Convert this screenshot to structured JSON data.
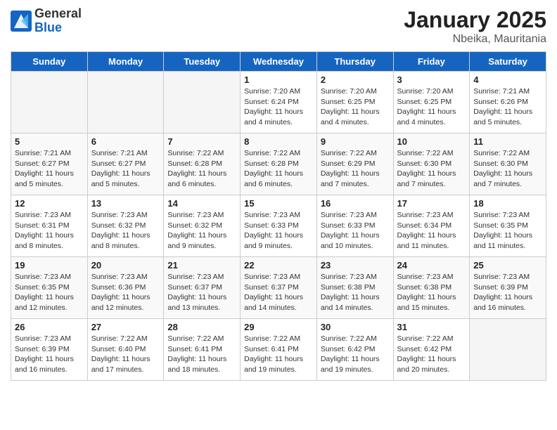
{
  "header": {
    "logo_general": "General",
    "logo_blue": "Blue",
    "month_title": "January 2025",
    "location": "Nbeika, Mauritania"
  },
  "weekdays": [
    "Sunday",
    "Monday",
    "Tuesday",
    "Wednesday",
    "Thursday",
    "Friday",
    "Saturday"
  ],
  "weeks": [
    [
      {
        "day": "",
        "sunrise": "",
        "sunset": "",
        "daylight": "",
        "empty": true
      },
      {
        "day": "",
        "sunrise": "",
        "sunset": "",
        "daylight": "",
        "empty": true
      },
      {
        "day": "",
        "sunrise": "",
        "sunset": "",
        "daylight": "",
        "empty": true
      },
      {
        "day": "1",
        "sunrise": "Sunrise: 7:20 AM",
        "sunset": "Sunset: 6:24 PM",
        "daylight": "Daylight: 11 hours and 4 minutes."
      },
      {
        "day": "2",
        "sunrise": "Sunrise: 7:20 AM",
        "sunset": "Sunset: 6:25 PM",
        "daylight": "Daylight: 11 hours and 4 minutes."
      },
      {
        "day": "3",
        "sunrise": "Sunrise: 7:20 AM",
        "sunset": "Sunset: 6:25 PM",
        "daylight": "Daylight: 11 hours and 4 minutes."
      },
      {
        "day": "4",
        "sunrise": "Sunrise: 7:21 AM",
        "sunset": "Sunset: 6:26 PM",
        "daylight": "Daylight: 11 hours and 5 minutes."
      }
    ],
    [
      {
        "day": "5",
        "sunrise": "Sunrise: 7:21 AM",
        "sunset": "Sunset: 6:27 PM",
        "daylight": "Daylight: 11 hours and 5 minutes."
      },
      {
        "day": "6",
        "sunrise": "Sunrise: 7:21 AM",
        "sunset": "Sunset: 6:27 PM",
        "daylight": "Daylight: 11 hours and 5 minutes."
      },
      {
        "day": "7",
        "sunrise": "Sunrise: 7:22 AM",
        "sunset": "Sunset: 6:28 PM",
        "daylight": "Daylight: 11 hours and 6 minutes."
      },
      {
        "day": "8",
        "sunrise": "Sunrise: 7:22 AM",
        "sunset": "Sunset: 6:28 PM",
        "daylight": "Daylight: 11 hours and 6 minutes."
      },
      {
        "day": "9",
        "sunrise": "Sunrise: 7:22 AM",
        "sunset": "Sunset: 6:29 PM",
        "daylight": "Daylight: 11 hours and 7 minutes."
      },
      {
        "day": "10",
        "sunrise": "Sunrise: 7:22 AM",
        "sunset": "Sunset: 6:30 PM",
        "daylight": "Daylight: 11 hours and 7 minutes."
      },
      {
        "day": "11",
        "sunrise": "Sunrise: 7:22 AM",
        "sunset": "Sunset: 6:30 PM",
        "daylight": "Daylight: 11 hours and 7 minutes."
      }
    ],
    [
      {
        "day": "12",
        "sunrise": "Sunrise: 7:23 AM",
        "sunset": "Sunset: 6:31 PM",
        "daylight": "Daylight: 11 hours and 8 minutes."
      },
      {
        "day": "13",
        "sunrise": "Sunrise: 7:23 AM",
        "sunset": "Sunset: 6:32 PM",
        "daylight": "Daylight: 11 hours and 8 minutes."
      },
      {
        "day": "14",
        "sunrise": "Sunrise: 7:23 AM",
        "sunset": "Sunset: 6:32 PM",
        "daylight": "Daylight: 11 hours and 9 minutes."
      },
      {
        "day": "15",
        "sunrise": "Sunrise: 7:23 AM",
        "sunset": "Sunset: 6:33 PM",
        "daylight": "Daylight: 11 hours and 9 minutes."
      },
      {
        "day": "16",
        "sunrise": "Sunrise: 7:23 AM",
        "sunset": "Sunset: 6:33 PM",
        "daylight": "Daylight: 11 hours and 10 minutes."
      },
      {
        "day": "17",
        "sunrise": "Sunrise: 7:23 AM",
        "sunset": "Sunset: 6:34 PM",
        "daylight": "Daylight: 11 hours and 11 minutes."
      },
      {
        "day": "18",
        "sunrise": "Sunrise: 7:23 AM",
        "sunset": "Sunset: 6:35 PM",
        "daylight": "Daylight: 11 hours and 11 minutes."
      }
    ],
    [
      {
        "day": "19",
        "sunrise": "Sunrise: 7:23 AM",
        "sunset": "Sunset: 6:35 PM",
        "daylight": "Daylight: 11 hours and 12 minutes."
      },
      {
        "day": "20",
        "sunrise": "Sunrise: 7:23 AM",
        "sunset": "Sunset: 6:36 PM",
        "daylight": "Daylight: 11 hours and 12 minutes."
      },
      {
        "day": "21",
        "sunrise": "Sunrise: 7:23 AM",
        "sunset": "Sunset: 6:37 PM",
        "daylight": "Daylight: 11 hours and 13 minutes."
      },
      {
        "day": "22",
        "sunrise": "Sunrise: 7:23 AM",
        "sunset": "Sunset: 6:37 PM",
        "daylight": "Daylight: 11 hours and 14 minutes."
      },
      {
        "day": "23",
        "sunrise": "Sunrise: 7:23 AM",
        "sunset": "Sunset: 6:38 PM",
        "daylight": "Daylight: 11 hours and 14 minutes."
      },
      {
        "day": "24",
        "sunrise": "Sunrise: 7:23 AM",
        "sunset": "Sunset: 6:38 PM",
        "daylight": "Daylight: 11 hours and 15 minutes."
      },
      {
        "day": "25",
        "sunrise": "Sunrise: 7:23 AM",
        "sunset": "Sunset: 6:39 PM",
        "daylight": "Daylight: 11 hours and 16 minutes."
      }
    ],
    [
      {
        "day": "26",
        "sunrise": "Sunrise: 7:23 AM",
        "sunset": "Sunset: 6:39 PM",
        "daylight": "Daylight: 11 hours and 16 minutes."
      },
      {
        "day": "27",
        "sunrise": "Sunrise: 7:22 AM",
        "sunset": "Sunset: 6:40 PM",
        "daylight": "Daylight: 11 hours and 17 minutes."
      },
      {
        "day": "28",
        "sunrise": "Sunrise: 7:22 AM",
        "sunset": "Sunset: 6:41 PM",
        "daylight": "Daylight: 11 hours and 18 minutes."
      },
      {
        "day": "29",
        "sunrise": "Sunrise: 7:22 AM",
        "sunset": "Sunset: 6:41 PM",
        "daylight": "Daylight: 11 hours and 19 minutes."
      },
      {
        "day": "30",
        "sunrise": "Sunrise: 7:22 AM",
        "sunset": "Sunset: 6:42 PM",
        "daylight": "Daylight: 11 hours and 19 minutes."
      },
      {
        "day": "31",
        "sunrise": "Sunrise: 7:22 AM",
        "sunset": "Sunset: 6:42 PM",
        "daylight": "Daylight: 11 hours and 20 minutes."
      },
      {
        "day": "",
        "sunrise": "",
        "sunset": "",
        "daylight": "",
        "empty": true
      }
    ]
  ]
}
